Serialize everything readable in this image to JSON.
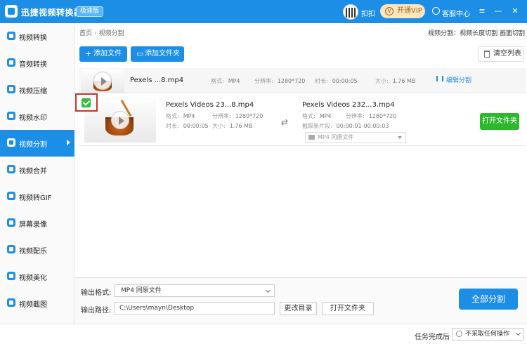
{
  "window": {
    "app_title": "迅捷视频转换器",
    "edition_badge": "极速版",
    "user_name": "扣扣",
    "vip_label": "开通VIP",
    "vip_icon": "V",
    "support_label": "客服中心"
  },
  "sidebar": {
    "items": [
      {
        "label": "视频转换",
        "icon": "video-convert-icon"
      },
      {
        "label": "音频转换",
        "icon": "audio-convert-icon"
      },
      {
        "label": "视频压缩",
        "icon": "video-compress-icon"
      },
      {
        "label": "视频水印",
        "icon": "video-watermark-icon"
      },
      {
        "label": "视频分割",
        "icon": "video-split-icon",
        "active": true
      },
      {
        "label": "视频合并",
        "icon": "video-merge-icon"
      },
      {
        "label": "视频转GIF",
        "icon": "video-gif-icon"
      },
      {
        "label": "屏幕录像",
        "icon": "screen-record-icon"
      },
      {
        "label": "视频配乐",
        "icon": "video-music-icon"
      },
      {
        "label": "视频美化",
        "icon": "video-beautify-icon"
      },
      {
        "label": "视频截图",
        "icon": "video-screenshot-icon"
      }
    ]
  },
  "header": {
    "breadcrumb_home": "首页",
    "breadcrumb_sep": "›",
    "breadcrumb_current": "视频分割",
    "mode_text": "视频分割：视频长度切割 画面切割"
  },
  "toolbar": {
    "add_file": "添加文件",
    "add_folder": "添加文件夹",
    "clear_list": "清空列表"
  },
  "file_row": {
    "name": "Pexels ...8.mp4",
    "format_label": "格式:",
    "format_value": "MP4",
    "resolution_label": "分辨率:",
    "resolution_value": "1280*720",
    "duration_label": "时长:",
    "duration_value": "00:00:05",
    "size_label": "大小:",
    "size_value": "1.76 MB",
    "edit_label": "编辑分割"
  },
  "segment_row": {
    "input_name": "Pexels Videos 23...8.mp4",
    "format_label": "格式:",
    "format_value": "MP4",
    "resolution_label": "分辨率:",
    "resolution_value": "1280*720",
    "duration_label": "时长:",
    "duration_value": "00:00:05",
    "size_label": "大小:",
    "size_value": "1.76 MB",
    "output_name": "Pexels Videos 232...3.mp4",
    "out_format_label": "格式:",
    "out_format_value": "MP4",
    "out_resolution_label": "分辨率:",
    "out_resolution_value": "1280*720",
    "cut_label": "截取新片段:",
    "cut_value": "00:00:01-00:00:03",
    "output_format_select": "MP4  同原文件",
    "open_folder": "打开文件夹"
  },
  "bottom": {
    "output_format_label": "输出格式:",
    "output_format_value": "MP4  同原文件",
    "output_path_label": "输出路径:",
    "output_path_value": "C:\\Users\\mayn\\Desktop",
    "change_dir": "更改目录",
    "open_folder": "打开文件夹",
    "split_all": "全部分割"
  },
  "status": {
    "after_label": "任务完成后",
    "after_value": "不采取任何操作"
  },
  "colors": {
    "accent": "#1d8ee6",
    "success": "#2db72d",
    "highlight": "#c0392b",
    "vip": "#fde5bd"
  }
}
